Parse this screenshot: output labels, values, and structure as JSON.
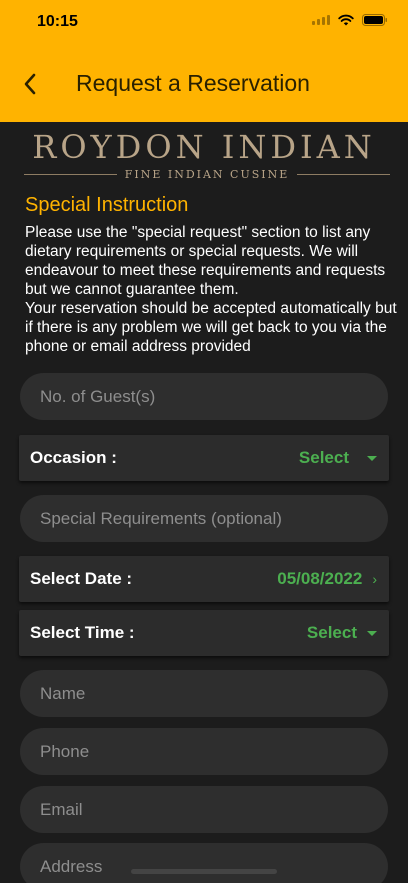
{
  "status_bar": {
    "time": "10:15"
  },
  "header": {
    "title": "Request a Reservation"
  },
  "brand": {
    "name": "ROYDON INDIAN",
    "tagline": "FINE INDIAN CUSINE"
  },
  "instructions": {
    "title": "Special Instruction",
    "text": "Please use the \"special request\" section to list any dietary requirements or special requests. We will endeavour to meet these requirements and requests but we cannot guarantee them.\nYour reservation should be accepted automatically but if there is any problem we will get back to you via the phone or email address provided"
  },
  "form": {
    "guests_placeholder": "No. of Guest(s)",
    "occasion": {
      "label": "Occasion :",
      "value": "Select"
    },
    "special_requirements_placeholder": "Special Requirements (optional)",
    "date": {
      "label": "Select Date :",
      "value": "05/08/2022"
    },
    "time": {
      "label": "Select Time :",
      "value": "Select"
    },
    "name_placeholder": "Name",
    "phone_placeholder": "Phone",
    "email_placeholder": "Email",
    "address_placeholder": "Address"
  },
  "colors": {
    "header": "#FFB300",
    "accent_green": "#4CAF50",
    "background": "#1c1c1c"
  },
  "icons": {
    "back": "chevron-left-icon",
    "dropdown": "caret-down-icon",
    "date_arrow": "chevron-right-icon"
  }
}
